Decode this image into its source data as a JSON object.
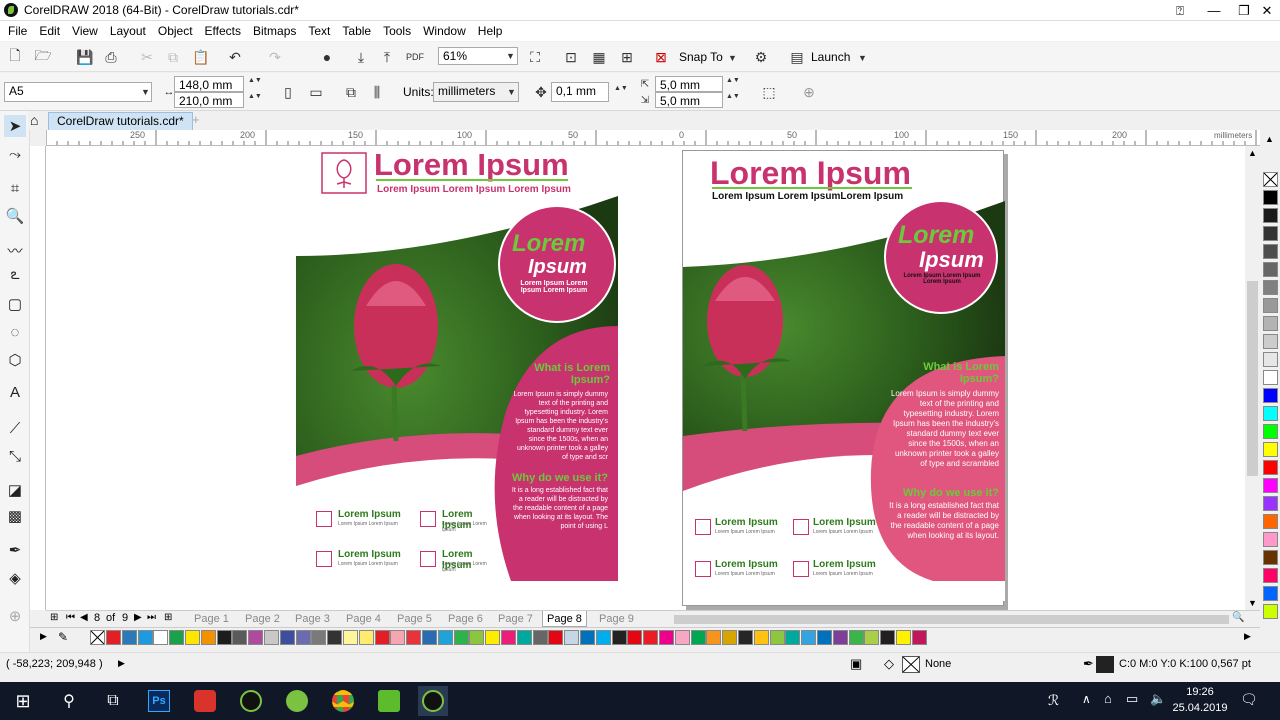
{
  "window": {
    "title": "CorelDRAW 2018 (64-Bit) - CorelDraw  tutorials.cdr*",
    "minimize": "—",
    "restore": "❐",
    "close": "✕"
  },
  "menu": [
    "File",
    "Edit",
    "View",
    "Layout",
    "Object",
    "Effects",
    "Bitmaps",
    "Text",
    "Table",
    "Tools",
    "Window",
    "Help"
  ],
  "toolbar": {
    "zoom": "61%",
    "snap": "Snap To",
    "launch": "Launch",
    "pdf": "PDF"
  },
  "propbar": {
    "page_size": "A5",
    "width": "148,0 mm",
    "height": "210,0 mm",
    "units_label": "Units:",
    "units": "millimeters",
    "nudge": "0,1 mm",
    "dup_x": "5,0 mm",
    "dup_y": "5,0 mm"
  },
  "doc_tab": "CorelDraw  tutorials.cdr*",
  "ruler": {
    "labels": [
      "250",
      "200",
      "150",
      "100",
      "50",
      "0",
      "50",
      "100",
      "150",
      "200"
    ],
    "unit": "millimeters"
  },
  "pagenav": {
    "current": "8",
    "of": "of",
    "total": "9",
    "pages": [
      "Page 1",
      "Page 2",
      "Page 3",
      "Page 4",
      "Page 5",
      "Page 6",
      "Page 7",
      "Page 8",
      "Page 9"
    ],
    "active_index": 7
  },
  "design_left": {
    "title": "Lorem Ipsum",
    "subtitle": "Lorem Ipsum Lorem Ipsum Lorem Ipsum",
    "circle_big": "Lorem",
    "circle_ipsum": "Ipsum",
    "circle_small": "Lorem Ipsum Lorem Ipsum Lorem Ipsum",
    "q1": "What is Lorem Ipsum?",
    "p1": "Lorem Ipsum is simply dummy text of the printing and typesetting industry. Lorem Ipsum has been the industry's standard dummy text ever since the 1500s, when an unknown printer took a galley of type and scr",
    "q2": "Why do we use it?",
    "p2": "It is a long established fact that a reader will be distracted by the readable content of a page when looking at its layout. The point of using L",
    "item": "Lorem Ipsum",
    "item_sub": "Lorem Ipsum Lorem Ipsum"
  },
  "design_right": {
    "title": "Lorem Ipsum",
    "subtitle": "Lorem Ipsum Lorem IpsumLorem Ipsum",
    "circle_big": "Lorem",
    "circle_ipsum": "Ipsum",
    "circle_small": "Lorem Ipsum Lorem Ipsum Lorem Ipsum",
    "q1": "What is Lorem Ipsum?",
    "p1": "Lorem Ipsum is simply dummy text of the printing and typesetting industry. Lorem Ipsum has been the industry's standard dummy text ever since the 1500s, when an unknown printer took a galley of type and scrambled",
    "q2": "Why do we use it?",
    "p2": "It is a long established fact that a reader will be distracted by the readable content of a page when looking at its layout.",
    "item": "Lorem Ipsum",
    "item_sub": "Lorem Ipsum Lorem Ipsum"
  },
  "status": {
    "coords": "( -58,223; 209,948 )",
    "fill": "None",
    "outline": "C:0 M:0 Y:0 K:100  0,567 pt"
  },
  "clock": {
    "time": "19:26",
    "date": "25.04.2019"
  },
  "palette": [
    "#e31e24",
    "#2a7ab8",
    "#1e9be0",
    "#ffffff",
    "#19a24a",
    "#ffe600",
    "#f39200",
    "#1d1d1b",
    "#5a5a5a",
    "#b04a9c",
    "#c8c8c8",
    "#3d4e9e",
    "#6b6bb0",
    "#7a7a7a",
    "#333333",
    "#fff59b",
    "#ffec6e",
    "#e31e24",
    "#f5a6b0",
    "#e8333a",
    "#2a6cb4",
    "#1fa3d8",
    "#2cb34a",
    "#8cc63f",
    "#ffed00",
    "#ed1e79",
    "#00a99d",
    "#666666",
    "#e30613",
    "#c7d6e6",
    "#0072bc",
    "#00aeef",
    "#222222",
    "#e30613",
    "#ed1c24",
    "#ec008c",
    "#f7a6c4",
    "#00a651",
    "#f7941d",
    "#d8a400",
    "#262626",
    "#ffc20e",
    "#8dc63f",
    "#00a99d",
    "#34a4e0",
    "#0071bc",
    "#7f3f98",
    "#39b54a",
    "#a8cf45",
    "#231f20",
    "#fff200",
    "#c2185b"
  ],
  "right_palette": [
    "#000000",
    "#1a1a1a",
    "#333333",
    "#4d4d4d",
    "#666666",
    "#808080",
    "#999999",
    "#b3b3b3",
    "#cccccc",
    "#e6e6e6",
    "#ffffff",
    "#0000ff",
    "#00ffff",
    "#00ff00",
    "#ffff00",
    "#ff0000",
    "#ff00ff",
    "#9933ff",
    "#ff6600",
    "#ff99cc",
    "#663300",
    "#ff0066",
    "#0066ff",
    "#ccff00"
  ]
}
